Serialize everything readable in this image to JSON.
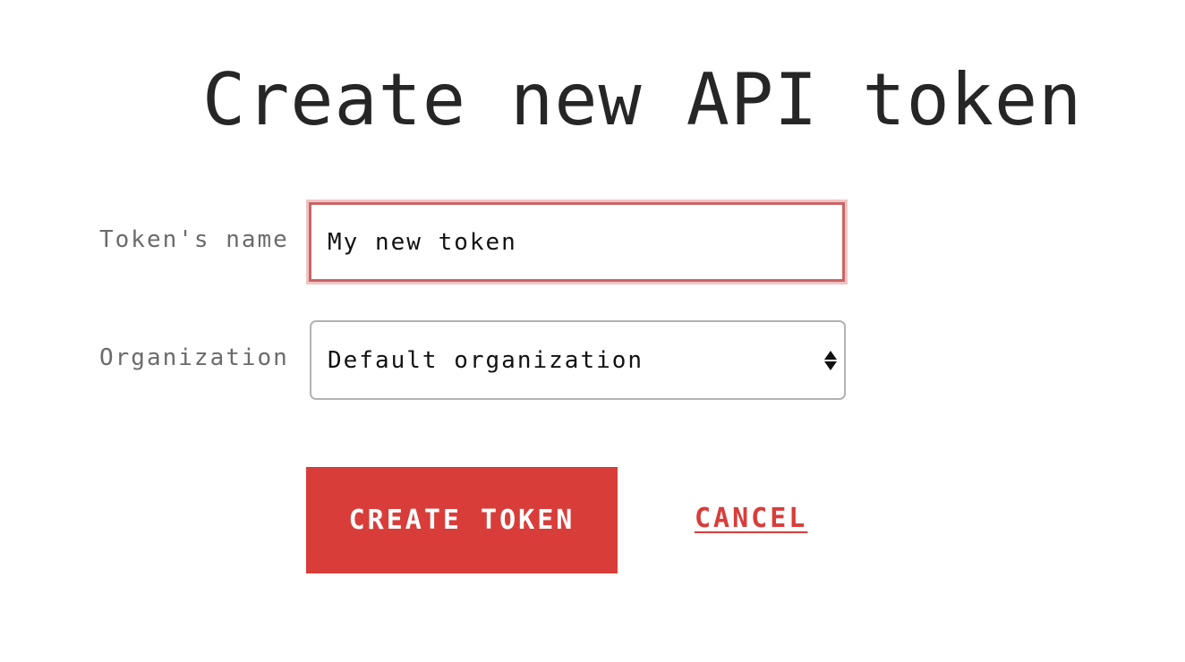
{
  "page": {
    "title": "Create new API token"
  },
  "form": {
    "name_label": "Token's name",
    "name_value": "My new token",
    "org_label": "Organization",
    "org_selected": "Default organization"
  },
  "actions": {
    "create_label": "CREATE TOKEN",
    "cancel_label": "CANCEL"
  },
  "colors": {
    "accent": "#d83d3a",
    "focus_border": "#c96565"
  }
}
